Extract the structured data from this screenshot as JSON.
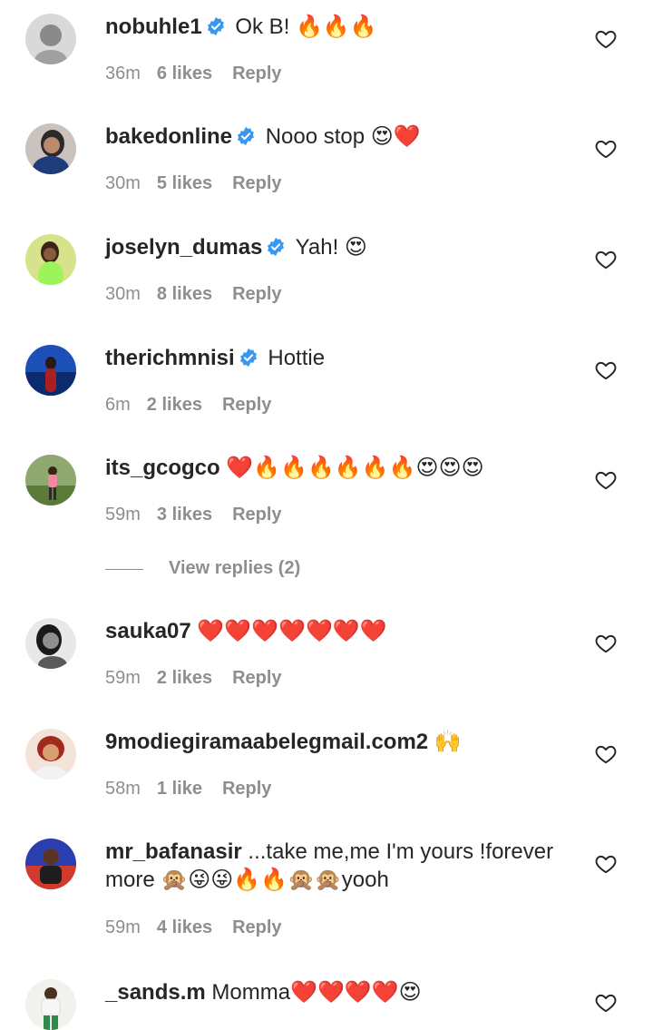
{
  "colors": {
    "text": "#262626",
    "meta": "#8e8e8e",
    "verified": "#3897f0"
  },
  "icons": {
    "verified": "verified-badge-icon",
    "like": "heart-outline-icon"
  },
  "view_replies": {
    "label": "View replies (2)"
  },
  "comments": [
    {
      "username": "nobuhle1",
      "verified": true,
      "text": "Ok B! 🔥🔥🔥",
      "time": "36m",
      "likes": "6 likes",
      "reply": "Reply"
    },
    {
      "username": "bakedonline",
      "verified": true,
      "text": "Nooo stop 😍❤️",
      "time": "30m",
      "likes": "5 likes",
      "reply": "Reply"
    },
    {
      "username": "joselyn_dumas",
      "verified": true,
      "text": "Yah! 😍",
      "time": "30m",
      "likes": "8 likes",
      "reply": "Reply"
    },
    {
      "username": "therichmnisi",
      "verified": true,
      "text": "Hottie",
      "time": "6m",
      "likes": "2 likes",
      "reply": "Reply"
    },
    {
      "username": "its_gcogco",
      "verified": false,
      "text": "❤️🔥🔥🔥🔥🔥🔥😍😍😍",
      "time": "59m",
      "likes": "3 likes",
      "reply": "Reply"
    },
    {
      "username": "sauka07",
      "verified": false,
      "text": "❤️❤️❤️❤️❤️❤️❤️",
      "time": "59m",
      "likes": "2 likes",
      "reply": "Reply"
    },
    {
      "username": "9modiegiramaabelegmail.com2",
      "verified": false,
      "text": "🙌",
      "time": "58m",
      "likes": "1 like",
      "reply": "Reply"
    },
    {
      "username": "mr_bafanasir",
      "verified": false,
      "text": "...take me,me I'm yours !forever more 🙊😜😜🔥🔥🙊🙊yooh",
      "time": "59m",
      "likes": "4 likes",
      "reply": "Reply"
    },
    {
      "username": "_sands.m",
      "verified": false,
      "text": "Momma❤️❤️❤️❤️😍",
      "time": "",
      "likes": "",
      "reply": ""
    }
  ]
}
